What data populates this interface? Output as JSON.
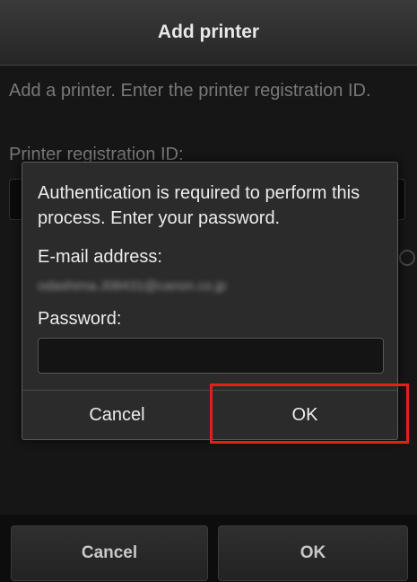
{
  "header": {
    "title": "Add printer"
  },
  "background": {
    "instruction": "Add a printer. Enter the printer registration ID.",
    "field_label": "Printer registration ID:"
  },
  "bottom_bar": {
    "cancel_label": "Cancel",
    "ok_label": "OK"
  },
  "dialog": {
    "message": "Authentication is required to perform this process. Enter your password.",
    "email_label": "E-mail address:",
    "email_value": "odashima.J08431@canon.co.jp",
    "password_label": "Password:",
    "password_value": "",
    "cancel_label": "Cancel",
    "ok_label": "OK"
  },
  "colors": {
    "highlight": "#e0201b",
    "background": "#222222",
    "titlebar": "#2f2f2f"
  }
}
